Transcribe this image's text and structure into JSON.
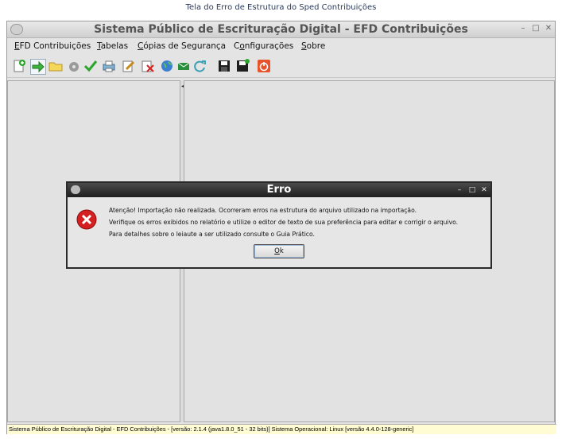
{
  "caption": "Tela do Erro de Estrutura do Sped Contribuições",
  "window": {
    "title": "Sistema Público de Escrituração Digital - EFD Contribuições",
    "controls": {
      "minimize": "–",
      "maximize": "□",
      "close": "✕"
    }
  },
  "menu": {
    "items": [
      {
        "label": "EFD Contribuições",
        "mnemonic": "E"
      },
      {
        "label": "Tabelas",
        "mnemonic": "T"
      },
      {
        "label": "Cópias de Segurança",
        "mnemonic": "C"
      },
      {
        "label": "Configurações",
        "mnemonic": "o"
      },
      {
        "label": "Sobre",
        "mnemonic": "S"
      }
    ]
  },
  "toolbar": {
    "icons": [
      "new-file-icon",
      "import-arrow-icon",
      "open-folder-icon",
      "gear-disabled-icon",
      "validate-check-icon",
      "print-icon",
      "sign-icon",
      "delete-icon",
      "globe-icon",
      "mail-icon",
      "refresh-icon",
      "save-icon",
      "save-as-icon",
      "power-icon"
    ]
  },
  "splitter": {
    "arrows": "◀▶"
  },
  "status_bar": {
    "text": "Sistema Público de Escrituração Digital - EFD Contribuições - [versão: 2.1.4 (java1.8.0_51 - 32 bits)] Sistema Operacional: Linux [versão 4.4.0-128-generic]"
  },
  "dialog": {
    "title": "Erro",
    "controls": {
      "minimize": "–",
      "maximize": "□",
      "close": "✕"
    },
    "icon": "error-x-icon",
    "lines": [
      "Atenção! Importação não realizada. Ocorreram erros na estrutura do arquivo utilizado na importação.",
      "Verifique os erros exibidos no relatório e utilize o editor de texto de sua preferência para editar e corrigir o arquivo.",
      "Para detalhes sobre o leiaute a ser utilizado consulte o Guia Prático."
    ],
    "ok_label": "Ok"
  },
  "colors": {
    "status_bg": "#fffbd2",
    "dialog_title_bg": "#2b2b2b",
    "error_red": "#d42020"
  }
}
